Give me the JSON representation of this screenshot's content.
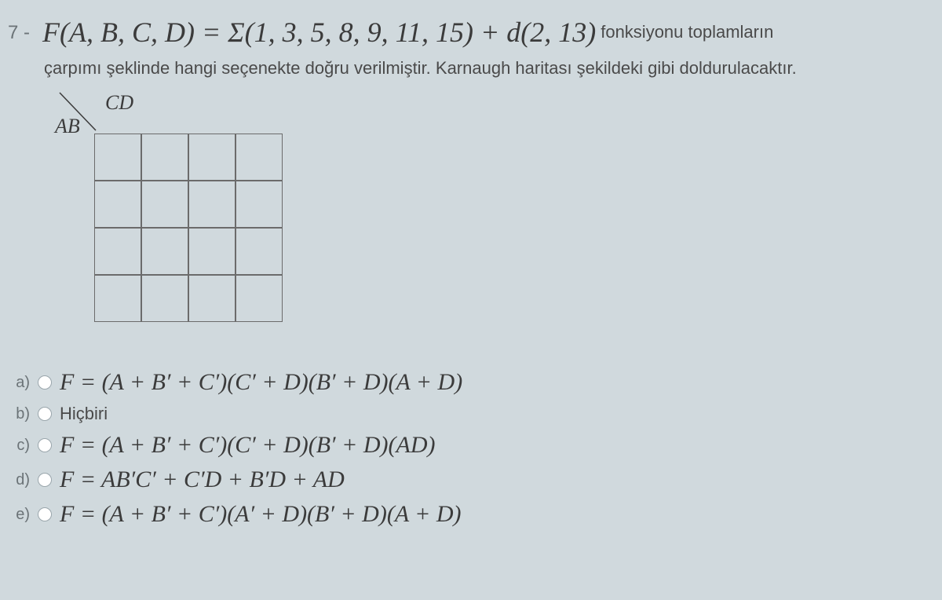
{
  "question_number": "7 -",
  "function_def": "F(A, B, C, D) = Σ(1, 3, 5, 8, 9, 11, 15) + d(2, 13)",
  "function_tail": "fonksiyonu toplamların",
  "subtitle": "çarpımı şeklinde hangi seçenekte doğru verilmiştir.  Karnaugh haritası şekildeki gibi doldurulacaktır.",
  "kmap": {
    "col_label": "CD",
    "row_label": "AB"
  },
  "options": {
    "a_letter": "a)",
    "a_text": "F = (A + B′ + C′)(C′ + D)(B′ + D)(A + D)",
    "b_letter": "b)",
    "b_text": "Hiçbiri",
    "c_letter": "c)",
    "c_text": "F = (A + B′ + C′)(C′ + D)(B′ + D)(AD)",
    "d_letter": "d)",
    "d_text": "F = AB′C′ + C′D + B′D + AD",
    "e_letter": "e)",
    "e_text": "F = (A + B′ + C′)(A′ + D)(B′ + D)(A + D)"
  }
}
